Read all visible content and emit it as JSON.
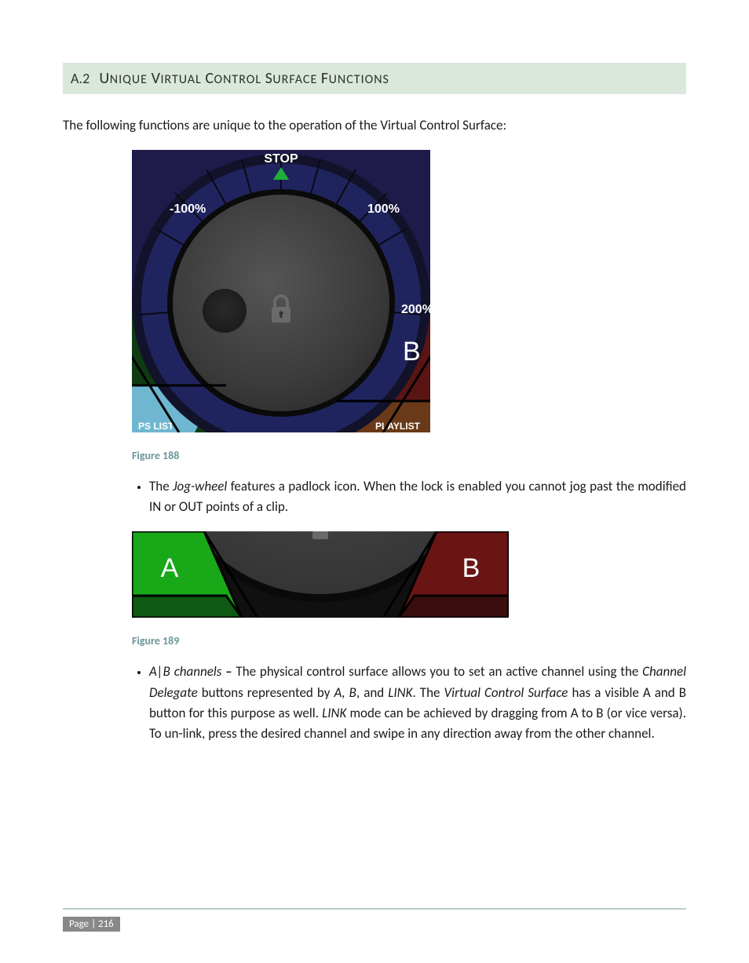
{
  "section": {
    "number": "A.2",
    "title_parts": [
      "U",
      "nique ",
      "V",
      "irtual ",
      "C",
      "ontrol ",
      "S",
      "urface ",
      "F",
      "unctions"
    ]
  },
  "intro": "The following functions are unique to the operation of the Virtual Control Surface:",
  "fig1": {
    "caption": "Figure 188",
    "labels": {
      "stop": "STOP",
      "neg100": "-100%",
      "pos100": "100%",
      "pos200": "200%",
      "b": "B",
      "playlist_right": "PLAYLIST",
      "list_left_partial": "PS LIST"
    }
  },
  "bullet1": {
    "lead_italic": "Jog-wheel",
    "prefix": "The ",
    "rest": " features a padlock icon. When the lock is enabled you cannot jog past the modified IN or OUT points of a clip."
  },
  "fig2": {
    "caption": "Figure 189",
    "labels": {
      "a": "A",
      "b": "B"
    }
  },
  "bullet2": {
    "lead_italic": "A|B channels",
    "dash": " – ",
    "t1": "The physical control surface allows you to set an active channel using the ",
    "i1": "Channel Delegate",
    "t2": " buttons represented by ",
    "i2": "A, B",
    "t3": ", and ",
    "i3": "LINK",
    "t4": ". The ",
    "i4": "Virtual Control Surface",
    "t5": " has a visible A and B button for this purpose as well. ",
    "i5": "LINK",
    "t6": " mode can be achieved by dragging from A to B (or vice versa). To un-link, press the desired channel and swipe in any direction away from the other channel."
  },
  "footer": {
    "label": "Page | 216"
  }
}
